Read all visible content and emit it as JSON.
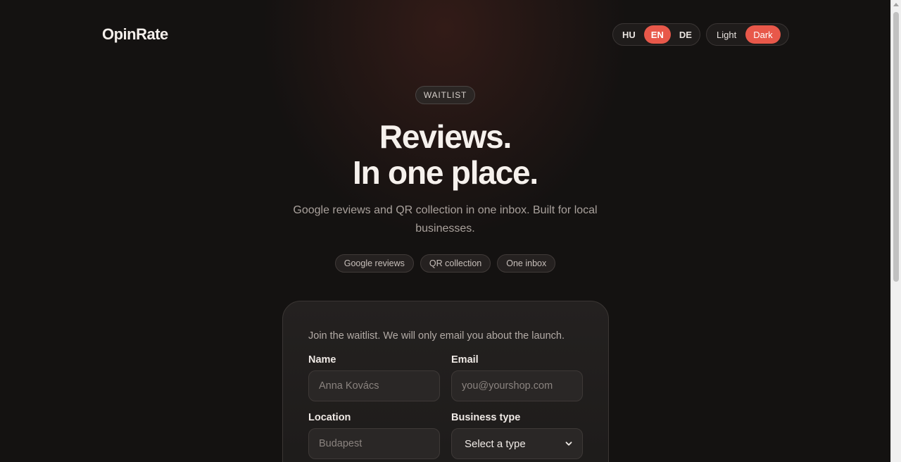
{
  "header": {
    "logo": "OpinRate",
    "languages": [
      {
        "label": "HU",
        "active": false
      },
      {
        "label": "EN",
        "active": true
      },
      {
        "label": "DE",
        "active": false
      }
    ],
    "themes": [
      {
        "label": "Light",
        "active": false
      },
      {
        "label": "Dark",
        "active": true
      }
    ]
  },
  "hero": {
    "badge": "WAITLIST",
    "title_line1": "Reviews.",
    "title_line2": "In one place.",
    "subtitle": "Google reviews and QR collection in one inbox. Built for local businesses.",
    "chips": [
      "Google reviews",
      "QR collection",
      "One inbox"
    ]
  },
  "form": {
    "intro": "Join the waitlist. We will only email you about the launch.",
    "name_label": "Name",
    "name_placeholder": "Anna Kovács",
    "email_label": "Email",
    "email_placeholder": "you@yourshop.com",
    "location_label": "Location",
    "location_placeholder": "Budapest",
    "business_type_label": "Business type",
    "business_type_value": "Select a type"
  },
  "colors": {
    "accent": "#e8584a",
    "background": "#141211"
  }
}
